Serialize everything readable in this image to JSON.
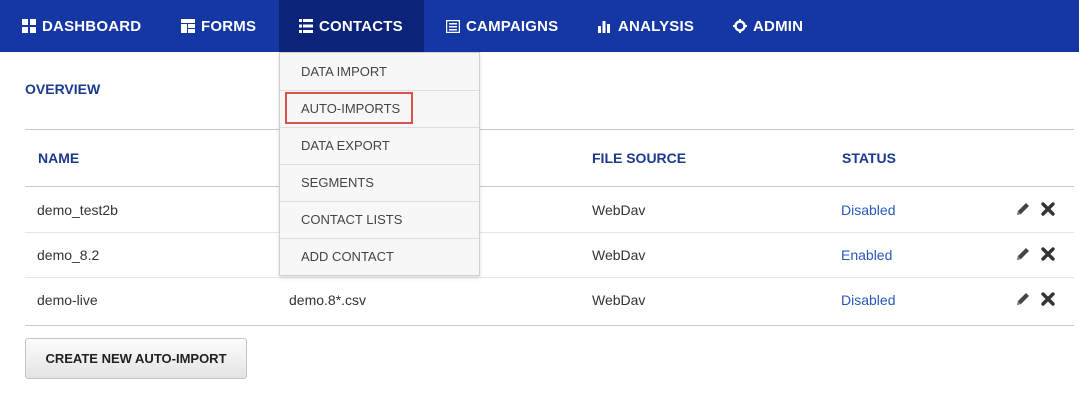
{
  "nav": {
    "dashboard": "DASHBOARD",
    "forms": "FORMS",
    "contacts": "CONTACTS",
    "campaigns": "CAMPAIGNS",
    "analysis": "ANALYSIS",
    "admin": "ADMIN",
    "active": "CONTACTS",
    "bar_color": "#1437a3",
    "active_color": "#0b2378"
  },
  "section_title": "OVERVIEW",
  "table": {
    "headers": {
      "name": "NAME",
      "file_source": "FILE SOURCE",
      "status": "STATUS"
    },
    "rows": [
      {
        "name": "demo_test2b",
        "file_pattern": "",
        "file_source": "WebDav",
        "status": "Disabled"
      },
      {
        "name": "demo_8.2",
        "file_pattern": "",
        "file_source": "WebDav",
        "status": "Enabled"
      },
      {
        "name": "demo-live",
        "file_pattern": "demo.8*.csv",
        "file_source": "WebDav",
        "status": "Disabled"
      }
    ],
    "row_actions": [
      "pencil-icon",
      "close-icon"
    ]
  },
  "create_button": "CREATE NEW AUTO-IMPORT",
  "dropdown": {
    "items": [
      "DATA IMPORT",
      "AUTO-IMPORTS",
      "DATA EXPORT",
      "SEGMENTS",
      "CONTACT LISTS",
      "ADD CONTACT"
    ],
    "highlighted": "AUTO-IMPORTS",
    "highlight_color": "#d9534f"
  }
}
